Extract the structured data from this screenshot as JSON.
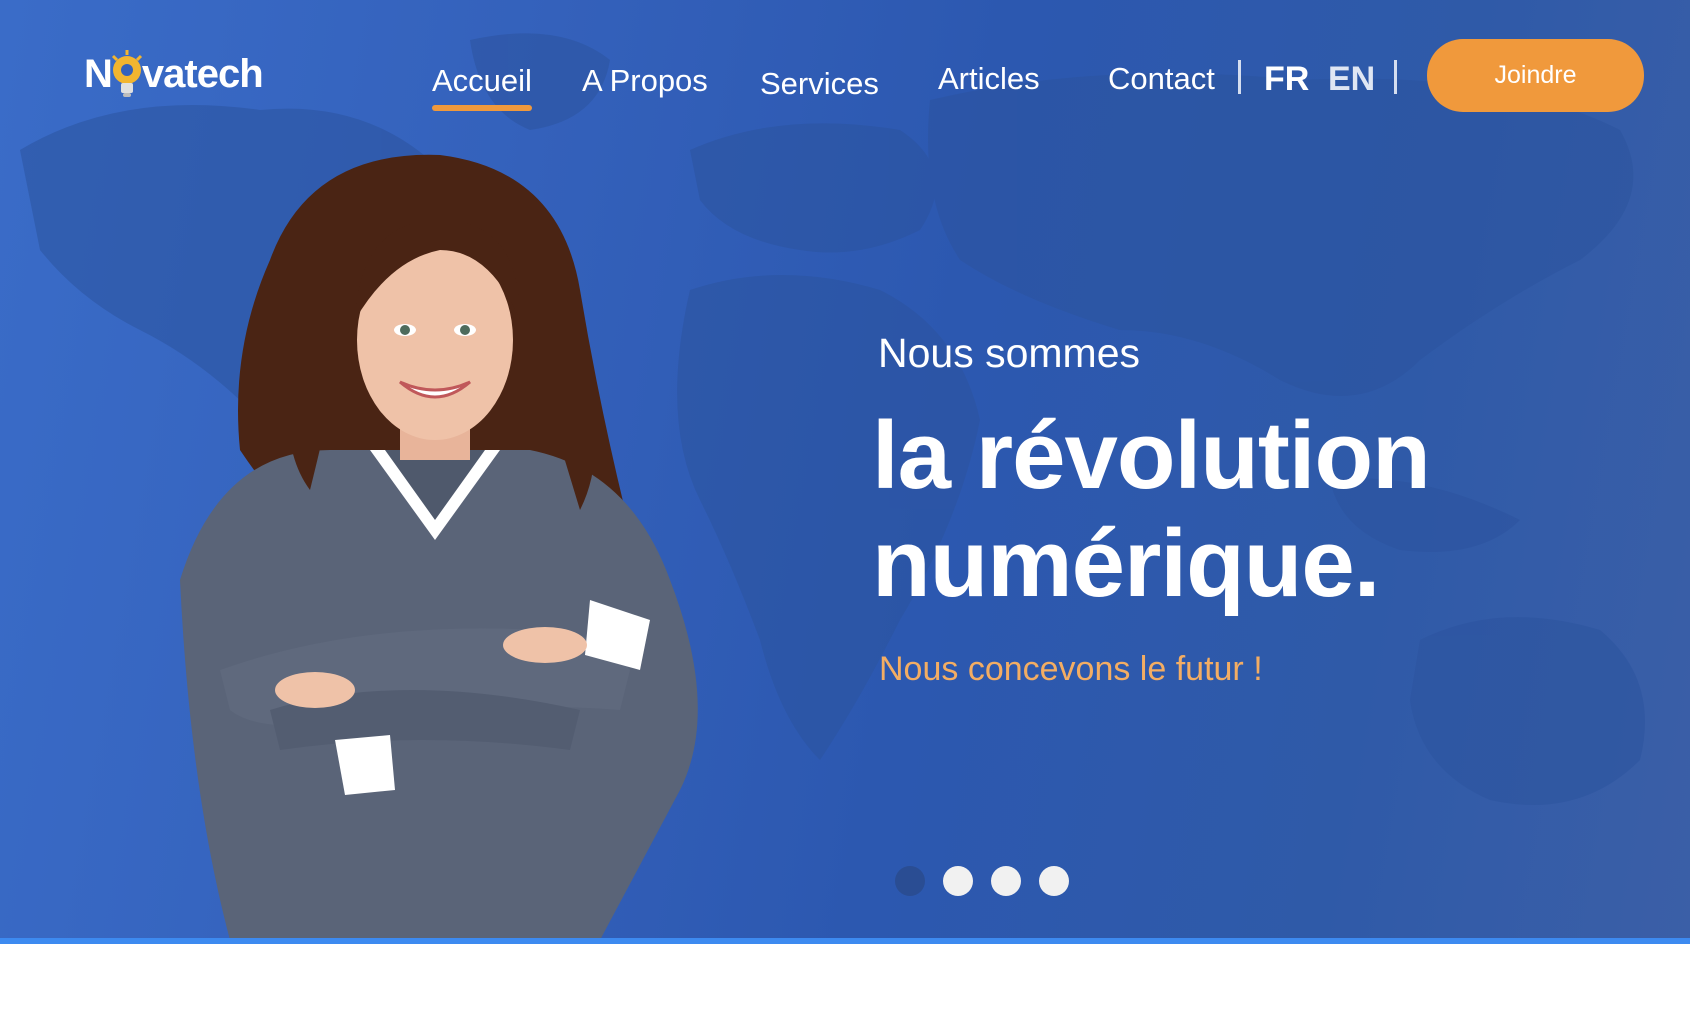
{
  "brand": {
    "name_prefix": "N",
    "name_suffix": "vatech"
  },
  "nav": {
    "items": [
      {
        "label": "Accueil",
        "active": true
      },
      {
        "label": "A Propos",
        "active": false
      },
      {
        "label": "Services",
        "active": false
      },
      {
        "label": "Articles",
        "active": false
      },
      {
        "label": "Contact",
        "active": false
      }
    ],
    "languages": [
      {
        "code": "FR",
        "selected": true
      },
      {
        "code": "EN",
        "selected": false
      }
    ],
    "cta_label": "Joindre"
  },
  "hero": {
    "eyebrow": "Nous sommes",
    "headline_line1": "la révolution",
    "headline_line2": "numérique.",
    "tagline": "Nous concevons le futur !",
    "slides_total": 4,
    "active_slide": 1
  },
  "colors": {
    "accent": "#f0993c",
    "hero_blue": "#3461bb",
    "tagline": "#f3ad63",
    "rule": "#3d8af0"
  }
}
